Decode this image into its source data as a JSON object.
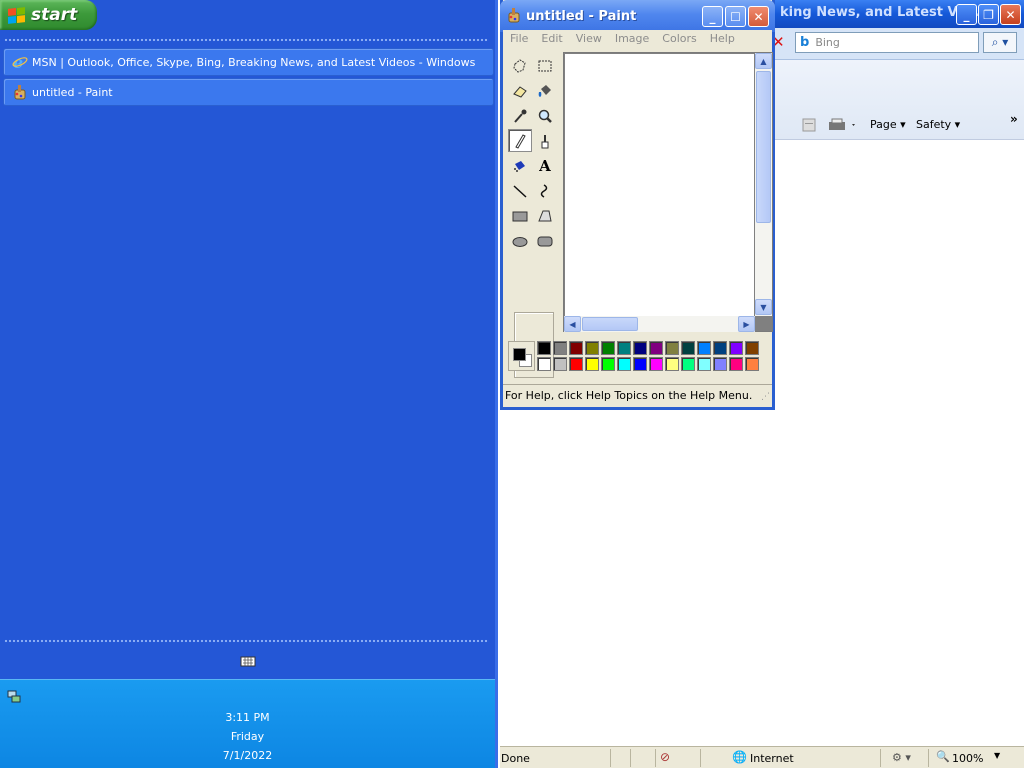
{
  "taskbar": {
    "start_label": "start",
    "tasks": [
      {
        "label": "MSN | Outlook, Office, Skype, Bing, Breaking News, and Latest Videos - Windows",
        "icon": "internet-explorer-icon"
      },
      {
        "label": "untitled - Paint",
        "icon": "paint-icon"
      }
    ],
    "clock": {
      "time": "3:11 PM",
      "day": "Friday",
      "date": "7/1/2022"
    }
  },
  "ie": {
    "title": "king News, and Latest Vid...",
    "search_placeholder": "Bing",
    "commands": {
      "page": "Page ▾",
      "safety": "Safety ▾"
    },
    "status": {
      "text": "Done",
      "zone": "Internet",
      "zoom": "100%"
    }
  },
  "paint": {
    "title": "untitled - Paint",
    "menu": [
      "File",
      "Edit",
      "View",
      "Image",
      "Colors",
      "Help"
    ],
    "status_text": "For Help, click Help Topics on the Help Menu.",
    "tools": [
      {
        "name": "free-form-select-tool-icon"
      },
      {
        "name": "rect-select-tool-icon"
      },
      {
        "name": "eraser-tool-icon"
      },
      {
        "name": "fill-tool-icon"
      },
      {
        "name": "color-picker-tool-icon"
      },
      {
        "name": "magnifier-tool-icon"
      },
      {
        "name": "pencil-tool-icon",
        "selected": true
      },
      {
        "name": "brush-tool-icon"
      },
      {
        "name": "airbrush-tool-icon"
      },
      {
        "name": "text-tool-icon"
      },
      {
        "name": "line-tool-icon"
      },
      {
        "name": "curve-tool-icon"
      },
      {
        "name": "rectangle-tool-icon"
      },
      {
        "name": "polygon-tool-icon"
      },
      {
        "name": "ellipse-tool-icon"
      },
      {
        "name": "rounded-rect-tool-icon"
      }
    ],
    "palette_top": [
      "#000000",
      "#808080",
      "#800000",
      "#808000",
      "#008000",
      "#008080",
      "#000080",
      "#800080",
      "#808040",
      "#004040",
      "#0080ff",
      "#004080",
      "#8000ff",
      "#804000"
    ],
    "palette_bottom": [
      "#ffffff",
      "#c0c0c0",
      "#ff0000",
      "#ffff00",
      "#00ff00",
      "#00ffff",
      "#0000ff",
      "#ff00ff",
      "#ffff80",
      "#00ff80",
      "#80ffff",
      "#8080ff",
      "#ff0080",
      "#ff8040"
    ],
    "foreground_color": "#000000",
    "background_color": "#ffffff"
  }
}
